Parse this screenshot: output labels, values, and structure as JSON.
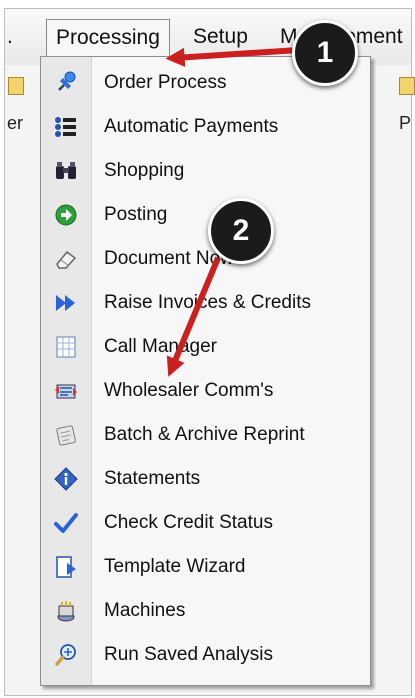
{
  "menubar": {
    "items": [
      {
        "label": "."
      },
      {
        "label": "Processing"
      },
      {
        "label": "Setup"
      },
      {
        "label": "Management"
      }
    ]
  },
  "toolbar": {
    "left_fragment": "er",
    "right_fragment": "P"
  },
  "menu": {
    "items": [
      {
        "label": "Order Process",
        "icon": "pushpin-icon"
      },
      {
        "label": "Automatic Payments",
        "icon": "bullet-list-icon"
      },
      {
        "label": "Shopping",
        "icon": "binoculars-icon"
      },
      {
        "label": "Posting",
        "icon": "green-arrow-circle-icon"
      },
      {
        "label": "Document Now",
        "icon": "eraser-icon"
      },
      {
        "label": "Raise Invoices & Credits",
        "icon": "double-arrow-icon"
      },
      {
        "label": "Call Manager",
        "icon": "grid-sheet-icon"
      },
      {
        "label": "Wholesaler Comm's",
        "icon": "sync-icon"
      },
      {
        "label": "Batch & Archive Reprint",
        "icon": "archive-icon"
      },
      {
        "label": "Statements",
        "icon": "info-diamond-icon"
      },
      {
        "label": "Check Credit Status",
        "icon": "checkmark-icon"
      },
      {
        "label": "Template Wizard",
        "icon": "document-arrow-icon"
      },
      {
        "label": "Machines",
        "icon": "machine-icon"
      },
      {
        "label": "Run Saved Analysis",
        "icon": "magnifier-icon"
      }
    ]
  },
  "annotations": [
    {
      "number": "1"
    },
    {
      "number": "2"
    }
  ],
  "colors": {
    "arrow": "#cc1f1f",
    "badge": "#1b1b1b"
  }
}
